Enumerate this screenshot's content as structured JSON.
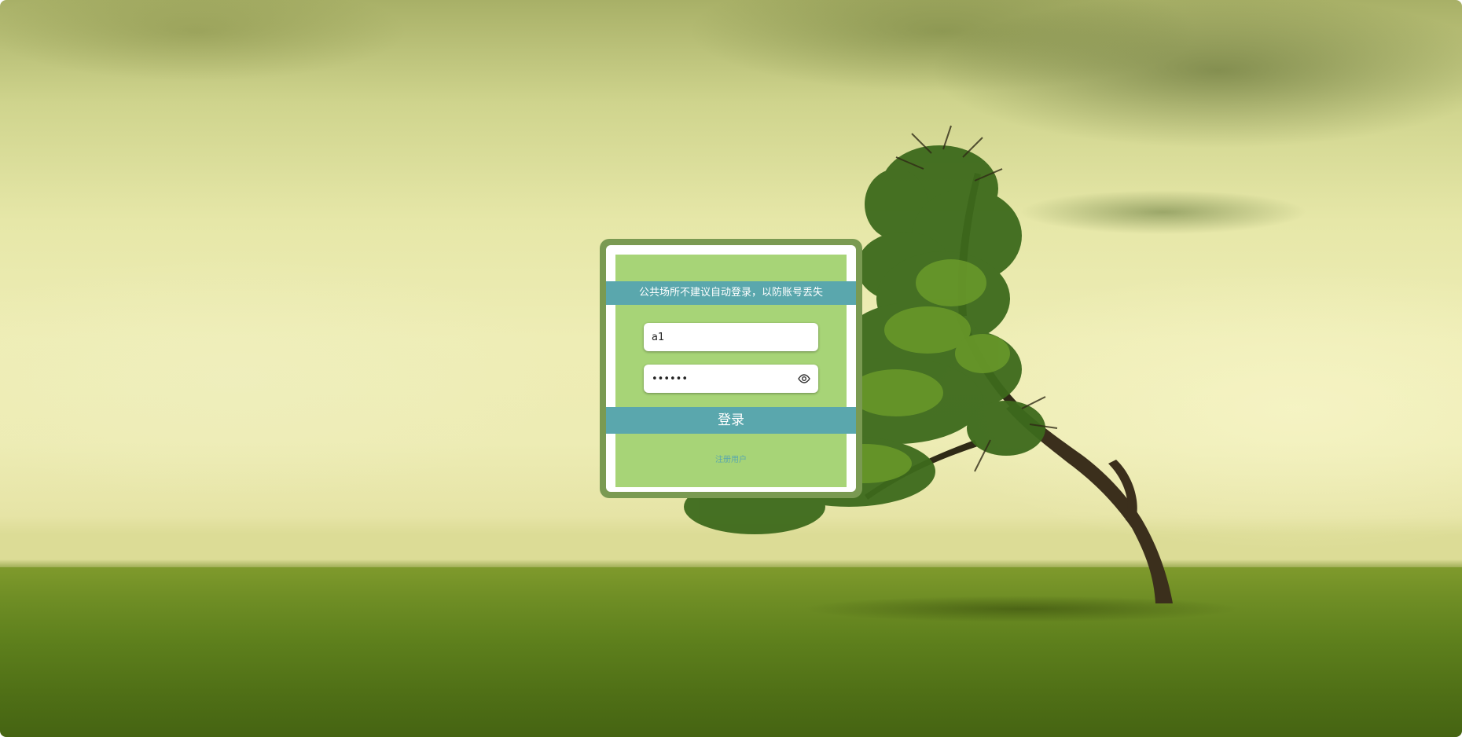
{
  "login": {
    "notice": "公共场所不建议自动登录，以防账号丢失",
    "username_value": "a1",
    "password_value": "••••••",
    "submit_label": "登录",
    "register_label": "注册用户"
  },
  "icons": {
    "password_toggle": "eye-icon"
  },
  "colors": {
    "frame": "#7a9a52",
    "panel": "#a7d477",
    "accent": "#5aa7ad",
    "text_on_accent": "#ffffff"
  }
}
